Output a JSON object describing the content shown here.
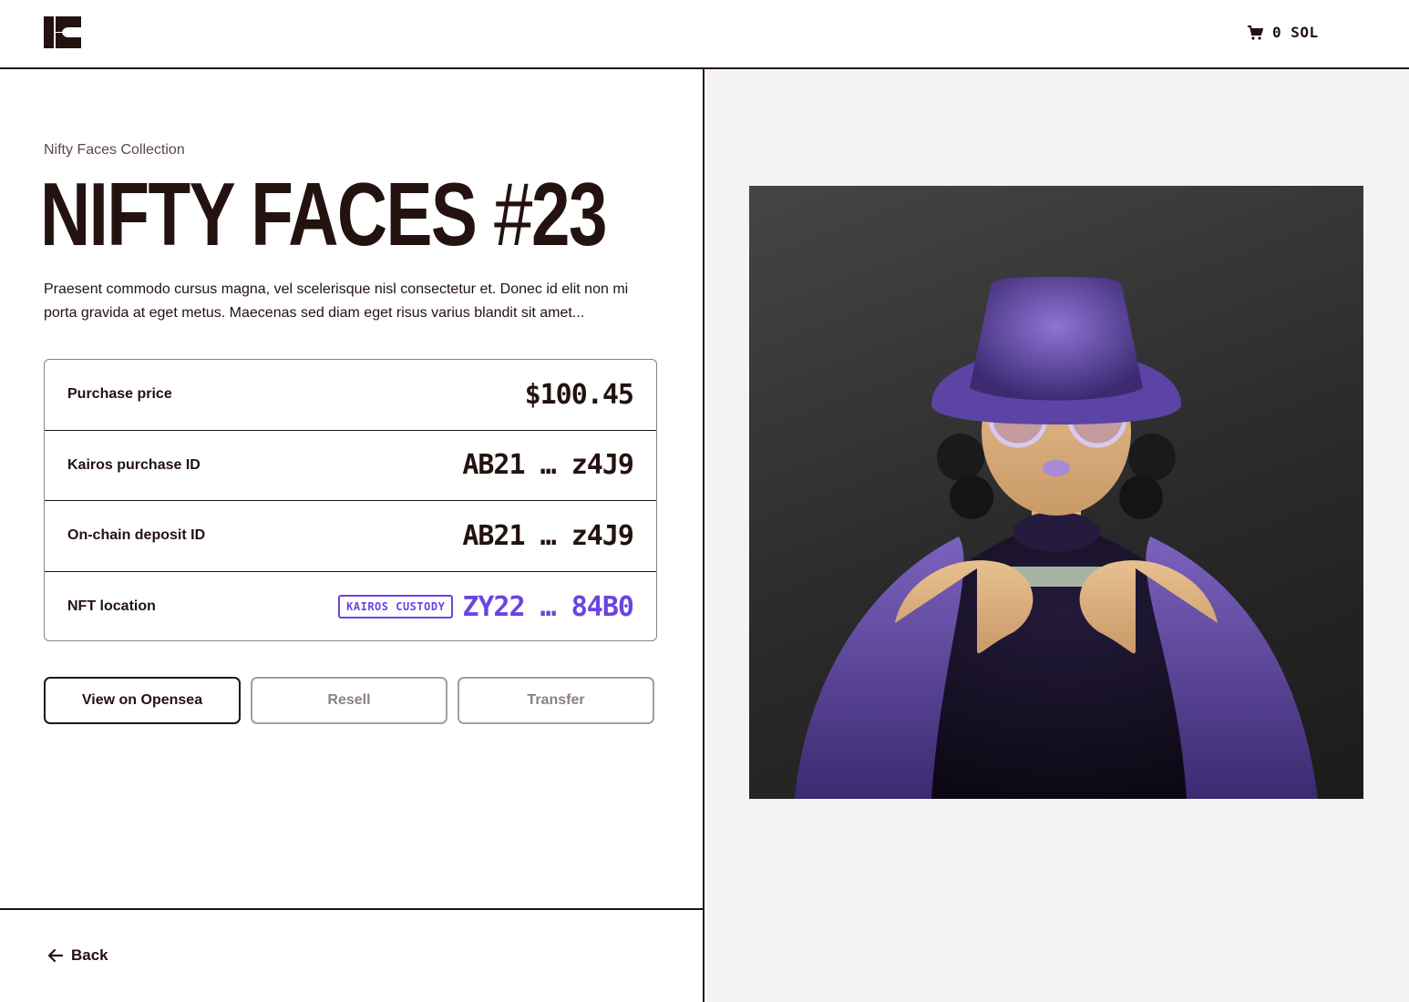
{
  "header": {
    "logo_icon": "kairos-logo-icon",
    "cart_icon": "cart-icon",
    "cart_text": "0 SOL"
  },
  "main": {
    "collection": "Nifty Faces Collection",
    "title_main": "NIFTY FACES ",
    "title_hash": "#",
    "title_number": "23",
    "description": "Praesent commodo cursus magna, vel scelerisque nisl consectetur et. Donec id elit non mi porta gravida at eget metus. Maecenas sed diam eget risus varius blandit sit amet...",
    "details": [
      {
        "label": "Purchase price",
        "value": "$100.45"
      },
      {
        "label": "Kairos purchase ID",
        "value": "AB21 … z4J9"
      },
      {
        "label": "On-chain deposit ID",
        "value": "AB21 … z4J9"
      },
      {
        "label": "NFT location",
        "badge": "KAIROS CUSTODY",
        "value": "ZY22 … 84B0"
      }
    ],
    "buttons": {
      "opensea": "View on Opensea",
      "resell": "Resell",
      "transfer": "Transfer"
    },
    "back": "Back"
  },
  "colors": {
    "ink": "#231210",
    "accent": "#6a45e0",
    "panel_bg": "#f4f3f1",
    "disabled": "#8c8080"
  }
}
